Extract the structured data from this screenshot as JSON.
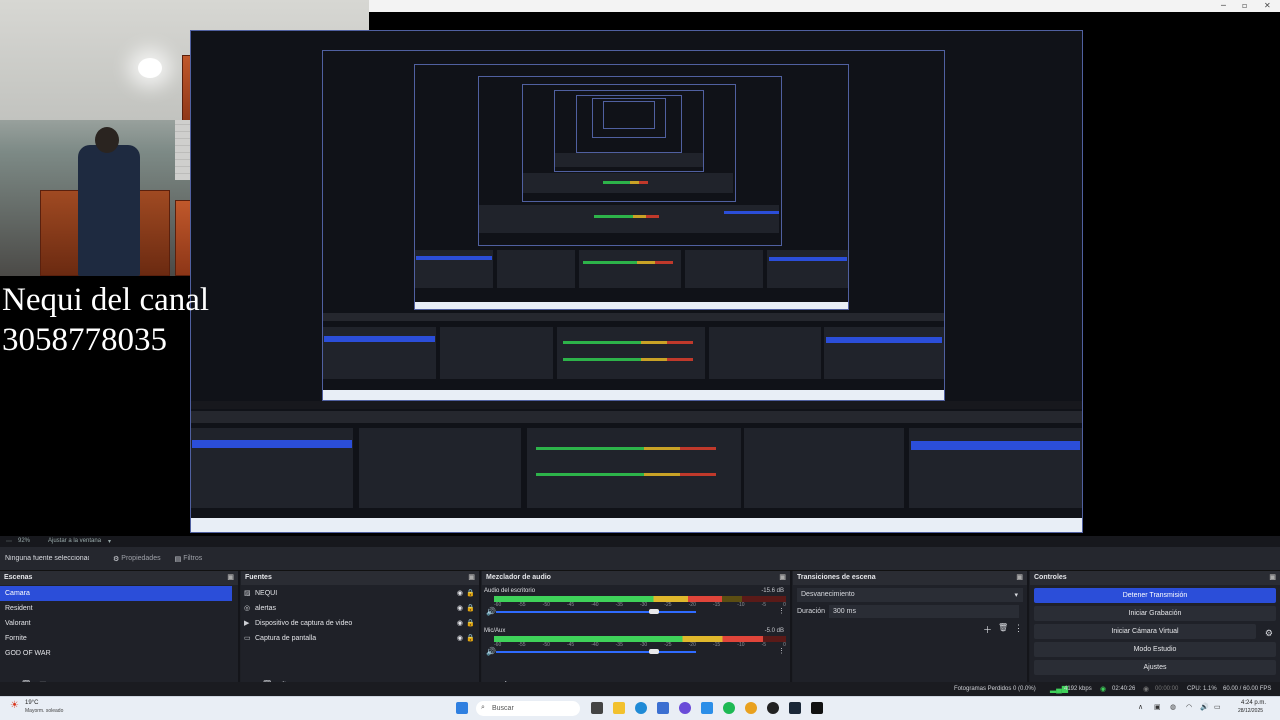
{
  "overlay": {
    "line1": "Nequi del canal",
    "line2": "3058778035"
  },
  "preview_bar": {
    "zoom": "92%",
    "fit_label": "Ajustar a la ventana"
  },
  "selection_bar": {
    "no_source": "Ninguna fuente seleccionada",
    "properties": "Propiedades",
    "filters": "Filtros"
  },
  "scenes": {
    "title": "Escenas",
    "items": [
      "Camara",
      "Resident",
      "Valorant",
      "Fornite",
      "GOD OF WAR"
    ],
    "selected_index": 0
  },
  "sources": {
    "title": "Fuentes",
    "items": [
      {
        "label": "NEQUI",
        "icon": "image-icon"
      },
      {
        "label": "alertas",
        "icon": "globe-icon"
      },
      {
        "label": "Dispositivo de captura de video",
        "icon": "camera-icon"
      },
      {
        "label": "Captura de pantalla",
        "icon": "monitor-icon"
      }
    ]
  },
  "mixer": {
    "title": "Mezclador de audio",
    "ticks": [
      "-60",
      "-55",
      "-50",
      "-45",
      "-40",
      "-35",
      "-30",
      "-25",
      "-20",
      "-15",
      "-10",
      "-5",
      "0"
    ],
    "channels": [
      {
        "name": "Audio del escritorio",
        "db": "-15.6 dB",
        "level": 0.78,
        "volume": 0.78
      },
      {
        "name": "Mic/Aux",
        "db": "-5.0 dB",
        "level": 0.92,
        "volume": 0.78
      }
    ]
  },
  "transitions": {
    "title": "Transiciones de escena",
    "selected": "Desvanecimiento",
    "duration_label": "Duración",
    "duration_value": "300 ms"
  },
  "controls": {
    "title": "Controles",
    "buttons": [
      {
        "label": "Detener Transmisión",
        "active": true
      },
      {
        "label": "Iniciar Grabación",
        "active": false
      },
      {
        "label": "Iniciar Cámara Virtual",
        "active": false
      },
      {
        "label": "Modo Estudio",
        "active": false
      },
      {
        "label": "Ajustes",
        "active": false
      }
    ]
  },
  "status": {
    "dropped": "Fotogramas Perdidos 0 (0.0%)",
    "bitrate": "4192 kbps",
    "stream_time": "02:40:26",
    "rec_time": "00:00:00",
    "cpu": "CPU: 1.1%",
    "fps": "60.00 / 60.00 FPS"
  },
  "taskbar": {
    "weather_temp": "19°C",
    "weather_desc": "Mayorm. soleado",
    "search": "Buscar",
    "time": "4:24 p.m.",
    "date": "28/12/2025"
  },
  "colors": {
    "accent": "#2b4ed9",
    "panel": "#1f2128",
    "meter_green": "#3fd25a",
    "meter_yellow": "#e0b82c",
    "meter_red": "#e0453a"
  }
}
